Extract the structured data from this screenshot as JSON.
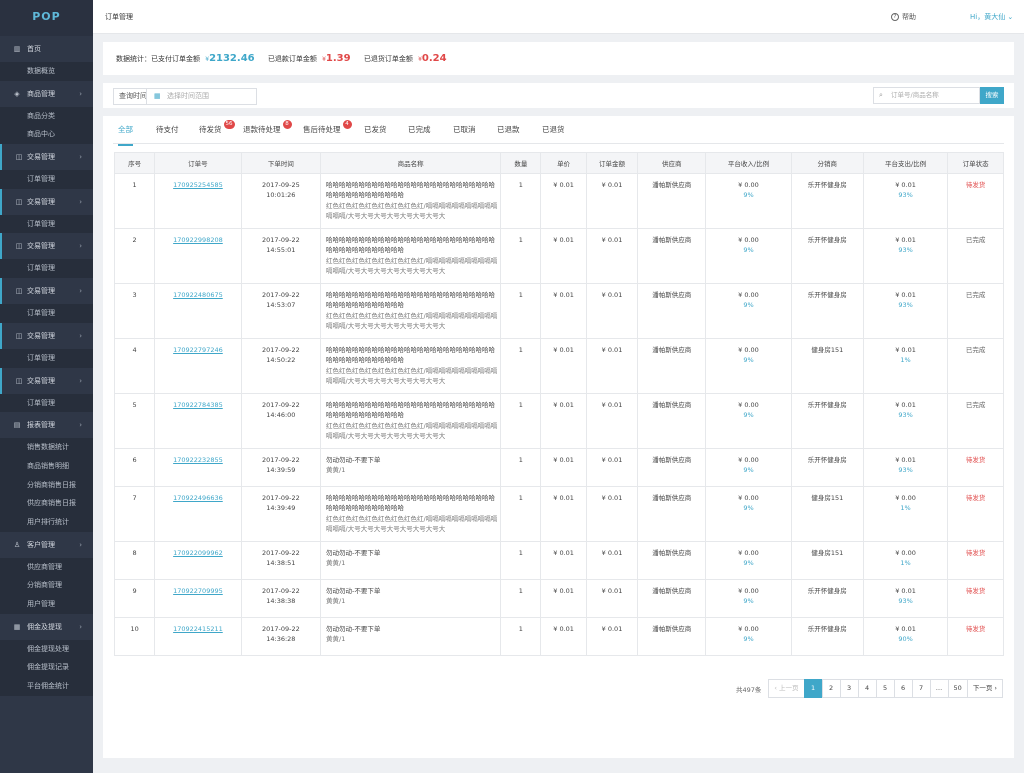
{
  "app": {
    "logo": "POP"
  },
  "topbar": {
    "title": "订单管理",
    "help_icon": "question-circle-icon",
    "help": "帮助",
    "user": "Hi，黄大仙 ⌄"
  },
  "sidebar": [
    {
      "icon": "▥",
      "icon_name": "grid-icon",
      "label": "首页",
      "chevron": "",
      "active": false,
      "subs": [
        "数据概览"
      ]
    },
    {
      "icon": "◈",
      "icon_name": "cube-icon",
      "label": "商品管理",
      "chevron": "›",
      "active": false,
      "subs": [
        "商品分类",
        "商品中心"
      ]
    },
    {
      "icon": "◫",
      "icon_name": "lock-icon",
      "label": "交易管理",
      "chevron": "›",
      "active": true,
      "subs": [
        "订单管理"
      ]
    },
    {
      "icon": "◫",
      "icon_name": "lock-icon",
      "label": "交易管理",
      "chevron": "›",
      "active": true,
      "subs": [
        "订单管理"
      ]
    },
    {
      "icon": "◫",
      "icon_name": "lock-icon",
      "label": "交易管理",
      "chevron": "›",
      "active": true,
      "subs": [
        "订单管理"
      ]
    },
    {
      "icon": "◫",
      "icon_name": "lock-icon",
      "label": "交易管理",
      "chevron": "›",
      "active": true,
      "subs": [
        "订单管理"
      ]
    },
    {
      "icon": "◫",
      "icon_name": "lock-icon",
      "label": "交易管理",
      "chevron": "›",
      "active": true,
      "subs": [
        "订单管理"
      ]
    },
    {
      "icon": "◫",
      "icon_name": "lock-icon",
      "label": "交易管理",
      "chevron": "›",
      "active": true,
      "subs": [
        "订单管理"
      ]
    },
    {
      "icon": "▤",
      "icon_name": "report-icon",
      "label": "报表管理",
      "chevron": "›",
      "active": false,
      "subs": [
        "销售数据统计",
        "商品销售明细",
        "分销商销售日报",
        "供应商销售日报",
        "用户排行统计"
      ]
    },
    {
      "icon": "♙",
      "icon_name": "user-icon",
      "label": "客户管理",
      "chevron": "›",
      "active": false,
      "subs": [
        "供应商管理",
        "分销商管理",
        "用户管理"
      ]
    },
    {
      "icon": "▦",
      "icon_name": "wallet-icon",
      "label": "佣金及提现",
      "chevron": "›",
      "active": false,
      "subs": [
        "佣金提现处理",
        "佣金提现记录",
        "平台佣金统计"
      ]
    }
  ],
  "stats": {
    "prefix": "数据统计：已支付订单金额",
    "currency": "¥",
    "paid": "2132.46",
    "refund_label": "已退款订单金额",
    "refund": "1.39",
    "return_label": "已退货订单金额",
    "returned": "0.24"
  },
  "filter": {
    "label": "查询时间",
    "calendar_icon": "calendar-icon",
    "placeholder": "选择时间范围",
    "search_icon": "search-icon",
    "search_placeholder": "订单号/商品名称",
    "search_button": "搜索"
  },
  "tabs": [
    {
      "label": "全部",
      "badge": "",
      "active": true
    },
    {
      "label": "待支付",
      "badge": ""
    },
    {
      "label": "待发货",
      "badge": "56"
    },
    {
      "label": "退款待处理",
      "badge": "8"
    },
    {
      "label": "售后待处理",
      "badge": "4"
    },
    {
      "label": "已发货",
      "badge": ""
    },
    {
      "label": "已完成",
      "badge": ""
    },
    {
      "label": "已取消",
      "badge": ""
    },
    {
      "label": "已退款",
      "badge": ""
    },
    {
      "label": "已退货",
      "badge": ""
    }
  ],
  "columns": [
    "序号",
    "订单号",
    "下单时间",
    "商品名称",
    "数量",
    "单价",
    "订单金额",
    "供应商",
    "平台收入/比例",
    "分销商",
    "平台支出/比例",
    "订单状态"
  ],
  "rows": [
    {
      "no": "1",
      "order": "170925254585",
      "date": "2017-09-25",
      "time": "10:01:26",
      "name1": "哈哈哈哈哈哈哈哈哈哈哈哈哈哈哈哈哈哈哈哈哈哈哈哈哈哈哈哈哈哈哈哈哈哈哈哈哈哈",
      "name2": "红色红色红色红色红色红色红色红/嗝嗝嗝嗝嗝嗝嗝嗝嗝嗝嗝嗝嗝嗝/大号大号大号大号大号大号大号大",
      "qty": "1",
      "price": "¥ 0.01",
      "amount": "¥ 0.01",
      "supplier": "潘帕斯供应商",
      "income": "¥ 0.00",
      "income_pct": "9%",
      "dist": "乐开怀健身房",
      "expense": "¥ 0.01",
      "expense_pct": "93%",
      "status": "待发货",
      "status_red": true
    },
    {
      "no": "2",
      "order": "170922998208",
      "date": "2017-09-22",
      "time": "14:55:01",
      "name1": "哈哈哈哈哈哈哈哈哈哈哈哈哈哈哈哈哈哈哈哈哈哈哈哈哈哈哈哈哈哈哈哈哈哈哈哈哈哈",
      "name2": "红色红色红色红色红色红色红色红/嗝嗝嗝嗝嗝嗝嗝嗝嗝嗝嗝嗝嗝嗝/大号大号大号大号大号大号大号大",
      "qty": "1",
      "price": "¥ 0.01",
      "amount": "¥ 0.01",
      "supplier": "潘帕斯供应商",
      "income": "¥ 0.00",
      "income_pct": "9%",
      "dist": "乐开怀健身房",
      "expense": "¥ 0.01",
      "expense_pct": "93%",
      "status": "已完成",
      "status_red": false
    },
    {
      "no": "3",
      "order": "170922480675",
      "date": "2017-09-22",
      "time": "14:53:07",
      "name1": "哈哈哈哈哈哈哈哈哈哈哈哈哈哈哈哈哈哈哈哈哈哈哈哈哈哈哈哈哈哈哈哈哈哈哈哈哈哈",
      "name2": "红色红色红色红色红色红色红色红/嗝嗝嗝嗝嗝嗝嗝嗝嗝嗝嗝嗝嗝嗝/大号大号大号大号大号大号大号大",
      "qty": "1",
      "price": "¥ 0.01",
      "amount": "¥ 0.01",
      "supplier": "潘帕斯供应商",
      "income": "¥ 0.00",
      "income_pct": "9%",
      "dist": "乐开怀健身房",
      "expense": "¥ 0.01",
      "expense_pct": "93%",
      "status": "已完成",
      "status_red": false
    },
    {
      "no": "4",
      "order": "170922797246",
      "date": "2017-09-22",
      "time": "14:50:22",
      "name1": "哈哈哈哈哈哈哈哈哈哈哈哈哈哈哈哈哈哈哈哈哈哈哈哈哈哈哈哈哈哈哈哈哈哈哈哈哈哈",
      "name2": "红色红色红色红色红色红色红色红/嗝嗝嗝嗝嗝嗝嗝嗝嗝嗝嗝嗝嗝嗝/大号大号大号大号大号大号大号大",
      "qty": "1",
      "price": "¥ 0.01",
      "amount": "¥ 0.01",
      "supplier": "潘帕斯供应商",
      "income": "¥ 0.00",
      "income_pct": "9%",
      "dist": "健身房151",
      "expense": "¥ 0.01",
      "expense_pct": "1%",
      "status": "已完成",
      "status_red": false
    },
    {
      "no": "5",
      "order": "170922784385",
      "date": "2017-09-22",
      "time": "14:46:00",
      "name1": "哈哈哈哈哈哈哈哈哈哈哈哈哈哈哈哈哈哈哈哈哈哈哈哈哈哈哈哈哈哈哈哈哈哈哈哈哈哈",
      "name2": "红色红色红色红色红色红色红色红/嗝嗝嗝嗝嗝嗝嗝嗝嗝嗝嗝嗝嗝嗝/大号大号大号大号大号大号大号大",
      "qty": "1",
      "price": "¥ 0.01",
      "amount": "¥ 0.01",
      "supplier": "潘帕斯供应商",
      "income": "¥ 0.00",
      "income_pct": "9%",
      "dist": "乐开怀健身房",
      "expense": "¥ 0.01",
      "expense_pct": "93%",
      "status": "已完成",
      "status_red": false
    },
    {
      "no": "6",
      "order": "170922232855",
      "date": "2017-09-22",
      "time": "14:39:59",
      "name1": "勿动勿动-不要下单",
      "name2": "黄黄/1",
      "qty": "1",
      "price": "¥ 0.01",
      "amount": "¥ 0.01",
      "supplier": "潘帕斯供应商",
      "income": "¥ 0.00",
      "income_pct": "9%",
      "dist": "乐开怀健身房",
      "expense": "¥ 0.01",
      "expense_pct": "93%",
      "status": "待发货",
      "status_red": true
    },
    {
      "no": "7",
      "order": "170922496636",
      "date": "2017-09-22",
      "time": "14:39:49",
      "name1": "哈哈哈哈哈哈哈哈哈哈哈哈哈哈哈哈哈哈哈哈哈哈哈哈哈哈哈哈哈哈哈哈哈哈哈哈哈哈",
      "name2": "红色红色红色红色红色红色红色红/嗝嗝嗝嗝嗝嗝嗝嗝嗝嗝嗝嗝嗝嗝/大号大号大号大号大号大号大号大",
      "qty": "1",
      "price": "¥ 0.01",
      "amount": "¥ 0.01",
      "supplier": "潘帕斯供应商",
      "income": "¥ 0.00",
      "income_pct": "9%",
      "dist": "健身房151",
      "expense": "¥ 0.00",
      "expense_pct": "1%",
      "status": "待发货",
      "status_red": true
    },
    {
      "no": "8",
      "order": "170922099962",
      "date": "2017-09-22",
      "time": "14:38:51",
      "name1": "勿动勿动-不要下单",
      "name2": "黄黄/1",
      "qty": "1",
      "price": "¥ 0.01",
      "amount": "¥ 0.01",
      "supplier": "潘帕斯供应商",
      "income": "¥ 0.00",
      "income_pct": "9%",
      "dist": "健身房151",
      "expense": "¥ 0.00",
      "expense_pct": "1%",
      "status": "待发货",
      "status_red": true
    },
    {
      "no": "9",
      "order": "170922709995",
      "date": "2017-09-22",
      "time": "14:38:38",
      "name1": "勿动勿动-不要下单",
      "name2": "黄黄/1",
      "qty": "1",
      "price": "¥ 0.01",
      "amount": "¥ 0.01",
      "supplier": "潘帕斯供应商",
      "income": "¥ 0.00",
      "income_pct": "9%",
      "dist": "乐开怀健身房",
      "expense": "¥ 0.01",
      "expense_pct": "93%",
      "status": "待发货",
      "status_red": true
    },
    {
      "no": "10",
      "order": "170922415211",
      "date": "2017-09-22",
      "time": "14:36:28",
      "name1": "勿动勿动-不要下单",
      "name2": "黄黄/1",
      "qty": "1",
      "price": "¥ 0.01",
      "amount": "¥ 0.01",
      "supplier": "潘帕斯供应商",
      "income": "¥ 0.00",
      "income_pct": "9%",
      "dist": "乐开怀健身房",
      "expense": "¥ 0.01",
      "expense_pct": "90%",
      "status": "待发货",
      "status_red": true
    }
  ],
  "pager": {
    "total": "共497条",
    "prev": "‹ 上一页",
    "pages": [
      "1",
      "2",
      "3",
      "4",
      "5",
      "6",
      "7",
      "…",
      "50"
    ],
    "current": "1",
    "next": "下一页 ›"
  },
  "colors": {
    "sidebar": "#2f3747",
    "accent": "#3fa7c9",
    "danger": "#e04848"
  }
}
